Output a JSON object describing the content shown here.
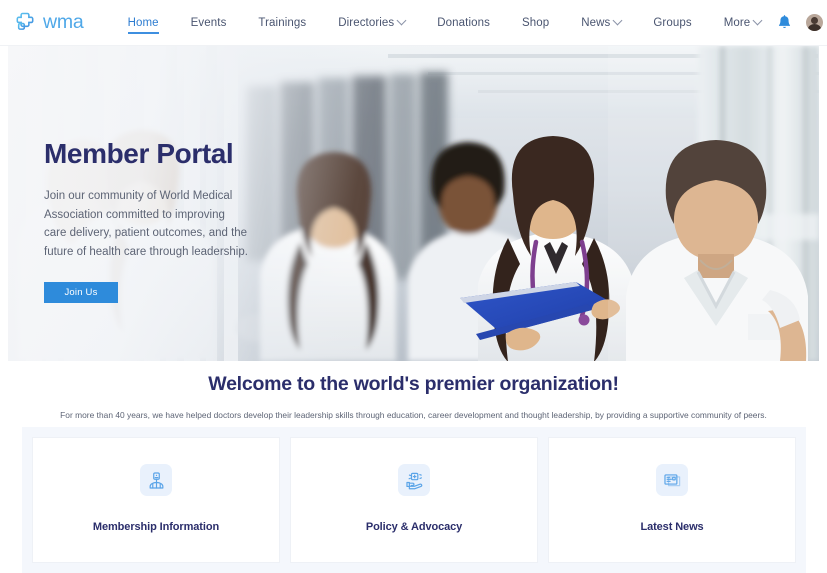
{
  "header": {
    "brand": {
      "text": "wma",
      "icon": "medical-cross-logo-icon"
    },
    "nav": [
      {
        "label": "Home",
        "active": true,
        "caret": false
      },
      {
        "label": "Events",
        "active": false,
        "caret": false
      },
      {
        "label": "Trainings",
        "active": false,
        "caret": false
      },
      {
        "label": "Directories",
        "active": false,
        "caret": true
      },
      {
        "label": "Donations",
        "active": false,
        "caret": false
      },
      {
        "label": "Shop",
        "active": false,
        "caret": false
      },
      {
        "label": "News",
        "active": false,
        "caret": true
      },
      {
        "label": "Groups",
        "active": false,
        "caret": false
      },
      {
        "label": "More",
        "active": false,
        "caret": true
      }
    ],
    "notification_icon": "bell-icon",
    "avatar_icon": "user-avatar",
    "accent_color": "#3E8FE0",
    "nav_text_color": "#4a5570"
  },
  "hero": {
    "title": "Member Portal",
    "subtitle": "Join our community of World Medical Association committed to improving care delivery, patient outcomes, and the future of health care through leadership.",
    "cta_label": "Join Us",
    "cta_color": "#2E8BDB",
    "title_color": "#2B2E6B",
    "image_alt": "Medical professionals in white coats walking and talking in a hospital corridor"
  },
  "welcome": {
    "title": "Welcome to the world's premier organization!",
    "subtitle": "For more than 40 years, we have helped doctors develop their leadership skills through education, career development and thought leadership, by providing a supportive community of peers."
  },
  "cards": {
    "panel_bg": "#f4f7fc",
    "items": [
      {
        "label": "Membership Information",
        "icon": "doctor-person-icon"
      },
      {
        "label": "Policy & Advocacy",
        "icon": "hand-holding-medical-icon"
      },
      {
        "label": "Latest News",
        "icon": "news-cards-icon"
      }
    ]
  }
}
